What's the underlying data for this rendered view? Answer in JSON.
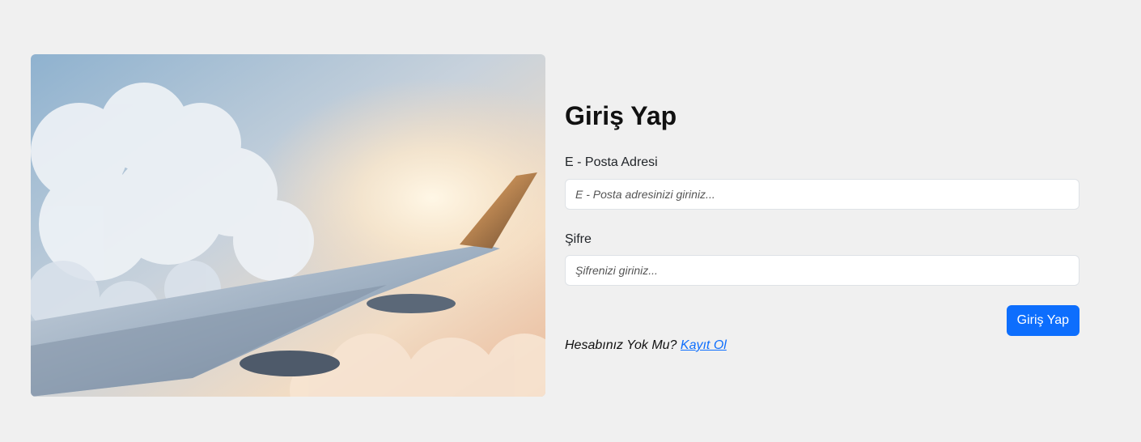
{
  "login": {
    "title": "Giriş Yap",
    "email_label": "E - Posta Adresi",
    "email_placeholder": "E - Posta adresinizi giriniz...",
    "email_value": "",
    "password_label": "Şifre",
    "password_placeholder": "Şifrenizi giriniz...",
    "password_value": "",
    "submit_label": "Giriş Yap",
    "no_account_text": "Hesabınız Yok Mu?",
    "signup_link": "Kayıt Ol"
  },
  "colors": {
    "background": "#f0f0f0",
    "primary": "#0d6efd"
  },
  "hero_image": {
    "icon": "airplane-wing-above-clouds"
  }
}
